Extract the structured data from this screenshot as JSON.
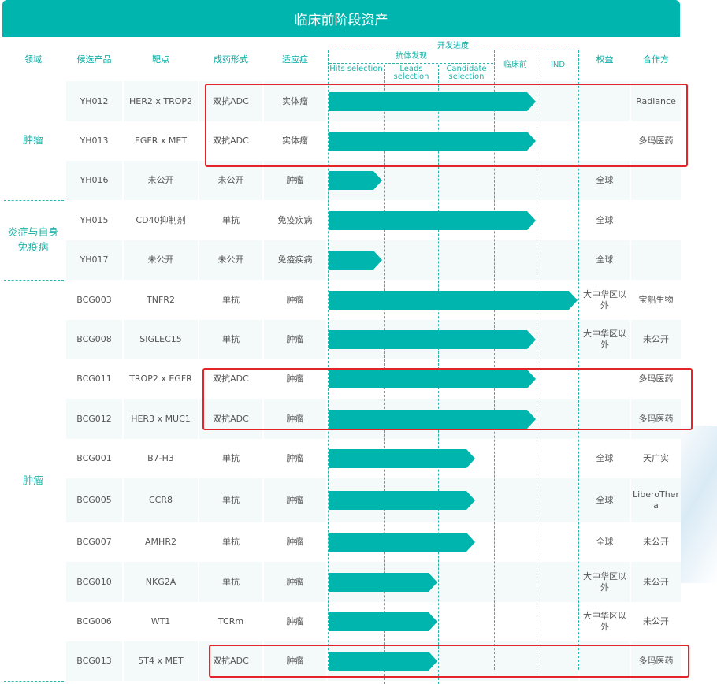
{
  "title": "临床前阶段资产",
  "headers": {
    "area": "领域",
    "candidate": "候选产品",
    "target": "靶点",
    "modality": "成药形式",
    "indication": "适应症",
    "progress": "开发进度",
    "antibody_discovery": "抗体发现",
    "hits": "Hits selection",
    "leads": "Leads selection",
    "candidate_sel": "Candidate selection",
    "preclinical": "临床前",
    "ind": "IND",
    "rights": "权益",
    "partner": "合作方"
  },
  "areas": [
    {
      "label": "肿瘤"
    },
    {
      "label": "炎症与自身免疫病"
    },
    {
      "label": "肿瘤"
    }
  ],
  "rows": [
    {
      "id": "YH012",
      "target": "HER2 x TROP2",
      "modality": "双抗ADC",
      "indication": "实体瘤",
      "progress_stage": "preclinical",
      "rights": "",
      "partner": "Radiance"
    },
    {
      "id": "YH013",
      "target": "EGFR x MET",
      "modality": "双抗ADC",
      "indication": "实体瘤",
      "progress_stage": "preclinical",
      "rights": "",
      "partner": "多玛医药"
    },
    {
      "id": "YH016",
      "target": "未公开",
      "modality": "未公开",
      "indication": "肿瘤",
      "progress_stage": "hits",
      "rights": "全球",
      "partner": ""
    },
    {
      "id": "YH015",
      "target": "CD40抑制剂",
      "modality": "单抗",
      "indication": "免疫疾病",
      "progress_stage": "preclinical",
      "rights": "全球",
      "partner": ""
    },
    {
      "id": "YH017",
      "target": "未公开",
      "modality": "未公开",
      "indication": "免疫疾病",
      "progress_stage": "hits",
      "rights": "全球",
      "partner": ""
    },
    {
      "id": "BCG003",
      "target": "TNFR2",
      "modality": "单抗",
      "indication": "肿瘤",
      "progress_stage": "ind",
      "rights": "大中华区以外",
      "partner": "宝船生物"
    },
    {
      "id": "BCG008",
      "target": "SIGLEC15",
      "modality": "单抗",
      "indication": "肿瘤",
      "progress_stage": "preclinical",
      "rights": "大中华区以外",
      "partner": "未公开"
    },
    {
      "id": "BCG011",
      "target": "TROP2 x EGFR",
      "modality": "双抗ADC",
      "indication": "肿瘤",
      "progress_stage": "preclinical",
      "rights": "",
      "partner": "多玛医药"
    },
    {
      "id": "BCG012",
      "target": "HER3 x MUC1",
      "modality": "双抗ADC",
      "indication": "肿瘤",
      "progress_stage": "preclinical",
      "rights": "",
      "partner": "多玛医药"
    },
    {
      "id": "BCG001",
      "target": "B7-H3",
      "modality": "单抗",
      "indication": "肿瘤",
      "progress_stage": "candidate",
      "rights": "全球",
      "partner": "天广实"
    },
    {
      "id": "BCG005",
      "target": "CCR8",
      "modality": "单抗",
      "indication": "肿瘤",
      "progress_stage": "candidate",
      "rights": "全球",
      "partner": "LiberoThera"
    },
    {
      "id": "BCG007",
      "target": "AMHR2",
      "modality": "单抗",
      "indication": "肿瘤",
      "progress_stage": "candidate",
      "rights": "全球",
      "partner": "未公开"
    },
    {
      "id": "BCG010",
      "target": "NKG2A",
      "modality": "单抗",
      "indication": "肿瘤",
      "progress_stage": "leads",
      "rights": "大中华区以外",
      "partner": "未公开"
    },
    {
      "id": "BCG006",
      "target": "WT1",
      "modality": "TCRm",
      "indication": "肿瘤",
      "progress_stage": "leads",
      "rights": "大中华区以外",
      "partner": "未公开"
    },
    {
      "id": "BCG013",
      "target": "5T4 x MET",
      "modality": "双抗ADC",
      "indication": "肿瘤",
      "progress_stage": "leads",
      "rights": "",
      "partner": "多玛医药"
    }
  ],
  "colors": {
    "teal": "#00b5ad",
    "highlight": "#e3242b",
    "row_alt": "#f4faf9"
  }
}
